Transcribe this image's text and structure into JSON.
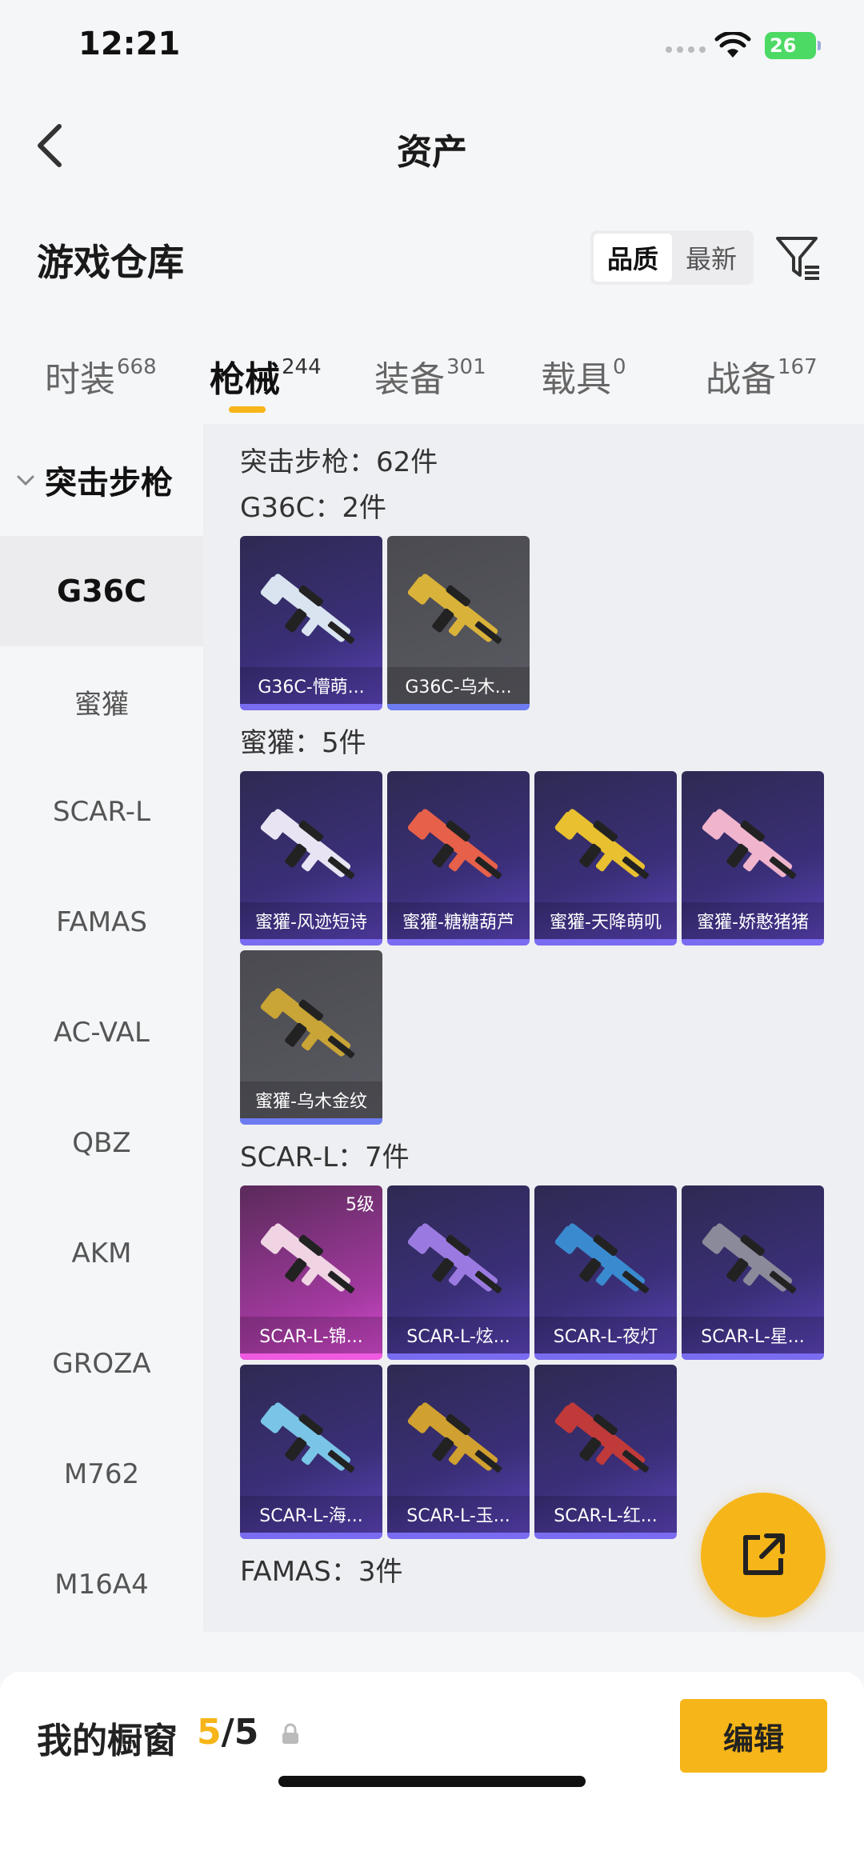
{
  "status": {
    "time": "12:21",
    "battery": "26"
  },
  "nav": {
    "title": "资产"
  },
  "header": {
    "title": "游戏仓库",
    "sort_options": [
      {
        "label": "品质"
      },
      {
        "label": "最新"
      }
    ]
  },
  "tabs": [
    {
      "label": "时装",
      "count": "668"
    },
    {
      "label": "枪械",
      "count": "244"
    },
    {
      "label": "装备",
      "count": "301"
    },
    {
      "label": "载具",
      "count": "0"
    },
    {
      "label": "战备",
      "count": "167"
    }
  ],
  "sidebar": {
    "group": "突击步枪",
    "items": [
      "G36C",
      "蜜獾",
      "SCAR-L",
      "FAMAS",
      "AC-VAL",
      "QBZ",
      "AKM",
      "GROZA",
      "M762",
      "M16A4"
    ]
  },
  "content": {
    "category": "突击步枪：62件",
    "groups": [
      {
        "title": "G36C：2件",
        "items": [
          {
            "label": "G36C-懵萌...",
            "color": "#d9e4f0"
          },
          {
            "label": "G36C-乌木...",
            "color": "#d9b23a"
          }
        ]
      },
      {
        "title": "蜜獾：5件",
        "items": [
          {
            "label": "蜜獾-风迹短诗",
            "color": "#e8e4f4"
          },
          {
            "label": "蜜獾-糖糖葫芦",
            "color": "#e6604a"
          },
          {
            "label": "蜜獾-天降萌叽",
            "color": "#e8c030"
          },
          {
            "label": "蜜獾-娇憨猪猪",
            "color": "#f0b4cc"
          },
          {
            "label": "蜜獾-乌木金纹",
            "color": "#c9a436"
          }
        ]
      },
      {
        "title": "SCAR-L：7件",
        "items": [
          {
            "label": "SCAR-L-锦...",
            "color": "#f0d4e4",
            "badge": "5级"
          },
          {
            "label": "SCAR-L-炫...",
            "color": "#9a7ae0"
          },
          {
            "label": "SCAR-L-夜灯",
            "color": "#3a8ad0"
          },
          {
            "label": "SCAR-L-星...",
            "color": "#8a8a9a"
          },
          {
            "label": "SCAR-L-海...",
            "color": "#7ac4e8"
          },
          {
            "label": "SCAR-L-玉...",
            "color": "#d0a030"
          },
          {
            "label": "SCAR-L-红...",
            "color": "#c03a3a"
          }
        ]
      },
      {
        "title": "FAMAS：3件",
        "items": []
      }
    ]
  },
  "bottom": {
    "window_label": "我的橱窗",
    "current": "5",
    "total": "/5",
    "edit_label": "编辑"
  }
}
